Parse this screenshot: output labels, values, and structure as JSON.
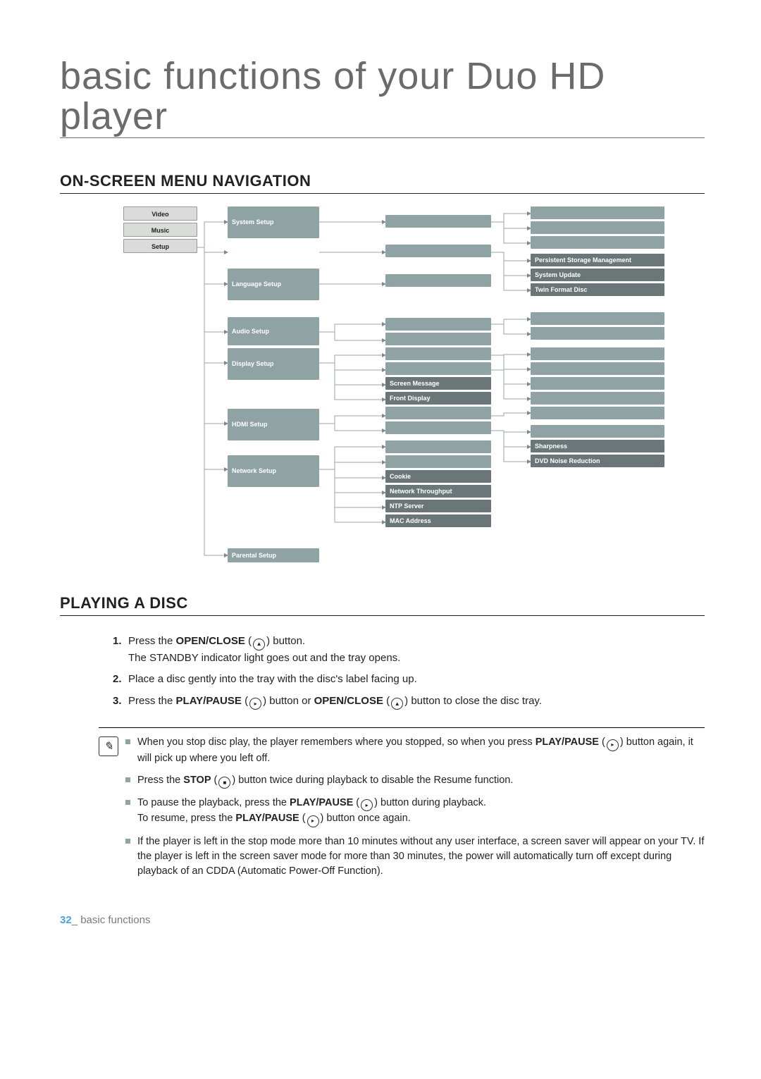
{
  "title": "basic functions of your Duo HD player",
  "section1": "ON-SCREEN MENU NAVIGATION",
  "section2": "PLAYING A DISC",
  "menu_a": {
    "video": "Video",
    "music": "Music",
    "setup": "Setup"
  },
  "menu_b": {
    "system": "System Setup",
    "language": "Language Setup",
    "audio": "Audio Setup",
    "display": "Display Setup",
    "hdmi": "HDMI Setup",
    "network": "Network Setup",
    "parental": "Parental Setup"
  },
  "menu_c": {
    "screen_message": "Screen Message",
    "front_display": "Front Display",
    "cookie": "Cookie",
    "network_throughput": "Network Throughput",
    "ntp_server": "NTP Server",
    "mac_address": "MAC Address"
  },
  "menu_d": {
    "persistent_storage": "Persistent Storage Management",
    "system_update": "System Update",
    "twin_format": "Twin Format Disc",
    "sharpness": "Sharpness",
    "dvd_noise": "DVD Noise Reduction"
  },
  "steps": {
    "s1a": "Press the ",
    "s1b": "OPEN/CLOSE",
    "s1c": " button.",
    "s1d": "The STANDBY indicator light goes out and the tray opens.",
    "s2": "Place a disc gently into the tray with the disc's label facing up.",
    "s3a": "Press the ",
    "s3b": "PLAY/PAUSE",
    "s3c": " button or ",
    "s3d": "OPEN/CLOSE",
    "s3e": " button to close the disc tray."
  },
  "icons": {
    "eject": "▲",
    "playpause": "▸",
    "stop": "■"
  },
  "notes": {
    "n1a": "When you stop disc play, the player remembers where you stopped, so when you press ",
    "n1b": "PLAY/PAUSE",
    "n1c": " button again, it will pick up where you left off.",
    "n2a": "Press the ",
    "n2b": "STOP",
    "n2c": " button twice during playback to disable the Resume function.",
    "n3a": "To pause the playback, press the ",
    "n3b": "PLAY/PAUSE",
    "n3c": " button during playback.",
    "n3d": "To resume, press the ",
    "n3e": "PLAY/PAUSE",
    "n3f": " button once again.",
    "n4": "If the player is left in the stop mode more than 10 minutes without any user interface, a screen saver will appear on your TV. If the player is left in the screen saver mode for more than 30 minutes, the power will automatically turn off except during playback of an CDDA (Automatic Power-Off Function)."
  },
  "footer": {
    "page": "32",
    "sep": "_ ",
    "label": "basic functions"
  }
}
